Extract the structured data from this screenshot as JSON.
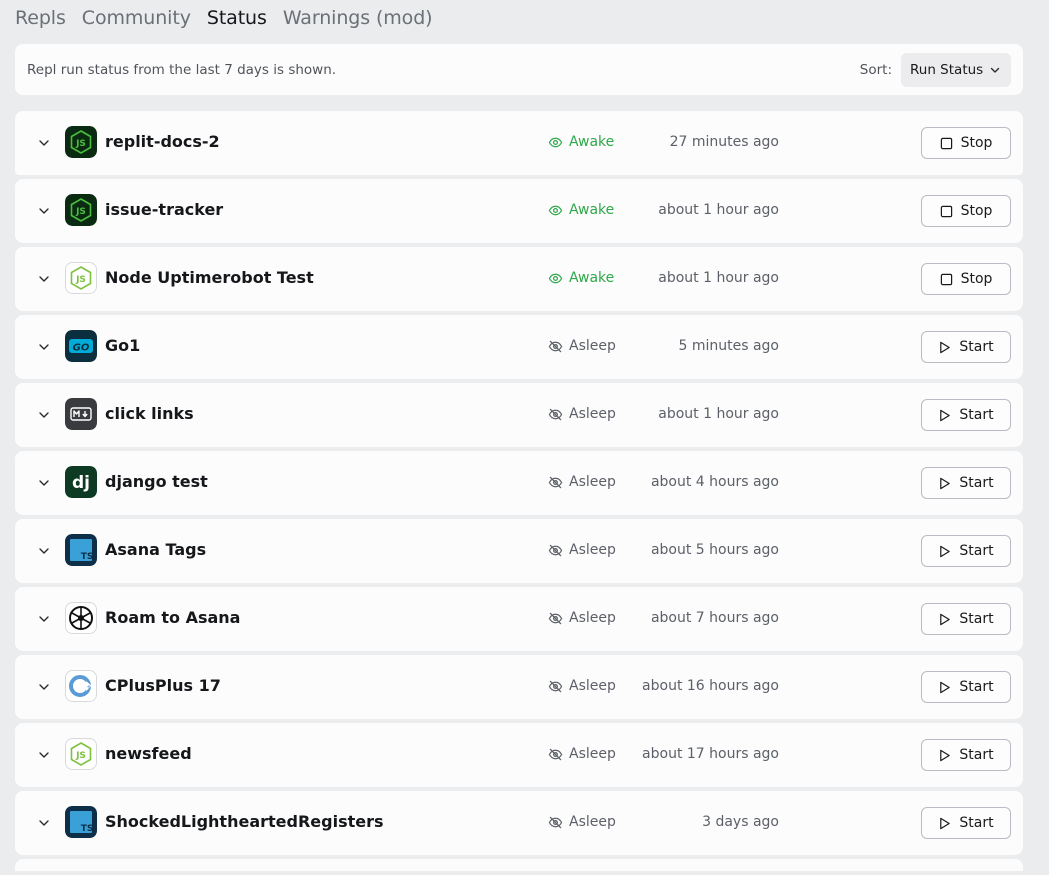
{
  "tabs": [
    {
      "label": "Repls",
      "active": false
    },
    {
      "label": "Community",
      "active": false
    },
    {
      "label": "Status",
      "active": true
    },
    {
      "label": "Warnings (mod)",
      "active": false
    }
  ],
  "info": {
    "text": "Repl run status from the last 7 days is shown.",
    "sort_label": "Sort:",
    "sort_value": "Run Status"
  },
  "repls": [
    {
      "name": "replit-docs-2",
      "icon": "nodejs-icon",
      "icon_style": "dark",
      "status": "Awake",
      "time": "27 minutes ago",
      "action": "Stop"
    },
    {
      "name": "issue-tracker",
      "icon": "nodejs-icon",
      "icon_style": "dark",
      "status": "Awake",
      "time": "about 1 hour ago",
      "action": "Stop"
    },
    {
      "name": "Node Uptimerobot Test",
      "icon": "nodejs-icon",
      "icon_style": "light",
      "status": "Awake",
      "time": "about 1 hour ago",
      "action": "Stop"
    },
    {
      "name": "Go1",
      "icon": "go-icon",
      "icon_style": "dark",
      "status": "Asleep",
      "time": "5 minutes ago",
      "action": "Start"
    },
    {
      "name": "click links",
      "icon": "markdown-icon",
      "icon_style": "dark",
      "status": "Asleep",
      "time": "about 1 hour ago",
      "action": "Start"
    },
    {
      "name": "django test",
      "icon": "django-icon",
      "icon_style": "dark",
      "status": "Asleep",
      "time": "about 4 hours ago",
      "action": "Start"
    },
    {
      "name": "Asana Tags",
      "icon": "typescript-icon",
      "icon_style": "dark",
      "status": "Asleep",
      "time": "about 5 hours ago",
      "action": "Start"
    },
    {
      "name": "Roam to Asana",
      "icon": "roam-icon",
      "icon_style": "light",
      "status": "Asleep",
      "time": "about 7 hours ago",
      "action": "Start"
    },
    {
      "name": "CPlusPlus 17",
      "icon": "cpp-icon",
      "icon_style": "light",
      "status": "Asleep",
      "time": "about 16 hours ago",
      "action": "Start"
    },
    {
      "name": "newsfeed",
      "icon": "nodejs-icon",
      "icon_style": "light",
      "status": "Asleep",
      "time": "about 17 hours ago",
      "action": "Start"
    },
    {
      "name": "ShockedLightheartedRegisters",
      "icon": "typescript-icon",
      "icon_style": "dark",
      "status": "Asleep",
      "time": "3 days ago",
      "action": "Start"
    }
  ],
  "colors": {
    "awake": "#2ea84a",
    "asleep": "#5c6068",
    "background": "#ebecee",
    "card": "#fcfcfc"
  }
}
